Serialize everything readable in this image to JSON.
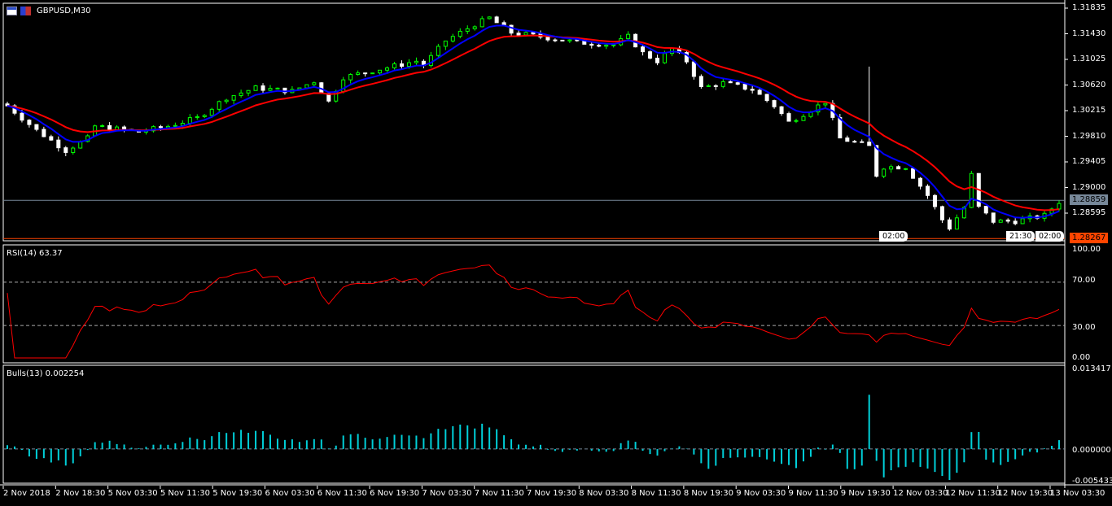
{
  "header": {
    "symbol_title": "GBPUSD,M30"
  },
  "colors": {
    "bull": "#00ff00",
    "bear": "#ffffff",
    "fast_ma": "#0000ff",
    "slow_ma": "#ff0000",
    "rsi": "#ff0000",
    "bulls": "#00cfd8",
    "bid_line": "#778899",
    "low_tag": "#ff4500"
  },
  "price_axis": {
    "labels": [
      "1.31835",
      "1.31430",
      "1.31025",
      "1.30620",
      "1.30215",
      "1.29810",
      "1.29405",
      "1.29000",
      "1.28595"
    ],
    "bid": "1.28859",
    "low": "1.28267"
  },
  "flags": [
    "02:00",
    "21:30",
    "02:00"
  ],
  "rsi": {
    "title": "RSI(14) 63.37",
    "labels": [
      "100.00",
      "70.00",
      "30.00",
      "0.00"
    ]
  },
  "bulls": {
    "title": "Bulls(13) 0.002254",
    "labels": [
      "0.013417",
      "0.000000",
      "-0.005433"
    ]
  },
  "time_axis": [
    "2 Nov 2018",
    "2 Nov 18:30",
    "5 Nov 03:30",
    "5 Nov 11:30",
    "5 Nov 19:30",
    "6 Nov 03:30",
    "6 Nov 11:30",
    "6 Nov 19:30",
    "7 Nov 03:30",
    "7 Nov 11:30",
    "7 Nov 19:30",
    "8 Nov 03:30",
    "8 Nov 11:30",
    "8 Nov 19:30",
    "9 Nov 03:30",
    "9 Nov 11:30",
    "9 Nov 19:30",
    "12 Nov 03:30",
    "12 Nov 11:30",
    "12 Nov 19:30",
    "13 Nov 03:30"
  ],
  "chart_data": {
    "type": "candlestick",
    "symbol": "GBPUSD",
    "timeframe": "M30",
    "bars": 145,
    "ylim": [
      1.28232,
      1.31911
    ],
    "close_anchors": [
      [
        0,
        1.30323
      ],
      [
        4,
        1.29945
      ],
      [
        8,
        1.2963
      ],
      [
        11,
        1.29819
      ],
      [
        12,
        1.30008
      ],
      [
        18,
        1.2992
      ],
      [
        22,
        1.30008
      ],
      [
        26,
        1.30134
      ],
      [
        30,
        1.30449
      ],
      [
        34,
        1.306
      ],
      [
        39,
        1.3055
      ],
      [
        42,
        1.30701
      ],
      [
        44,
        1.30386
      ],
      [
        46,
        1.30764
      ],
      [
        51,
        1.3089
      ],
      [
        56,
        1.31016
      ],
      [
        57,
        1.30953
      ],
      [
        60,
        1.31331
      ],
      [
        64,
        1.31583
      ],
      [
        66,
        1.31684
      ],
      [
        69,
        1.31457
      ],
      [
        73,
        1.31394
      ],
      [
        78,
        1.31306
      ],
      [
        83,
        1.31268
      ],
      [
        85,
        1.31394
      ],
      [
        87,
        1.31142
      ],
      [
        89,
        1.31016
      ],
      [
        91,
        1.31205
      ],
      [
        93,
        1.31016
      ],
      [
        95,
        1.306
      ],
      [
        98,
        1.30676
      ],
      [
        102,
        1.30575
      ],
      [
        105,
        1.30323
      ],
      [
        107,
        1.30071
      ],
      [
        110,
        1.3026
      ],
      [
        112,
        1.30386
      ],
      [
        114,
        1.29819
      ],
      [
        118,
        1.29693
      ],
      [
        119,
        1.29252
      ],
      [
        120,
        1.29378
      ],
      [
        123,
        1.29378
      ],
      [
        126,
        1.28937
      ],
      [
        128,
        1.28559
      ],
      [
        129,
        1.28433
      ],
      [
        131,
        1.28748
      ],
      [
        132,
        1.29252
      ],
      [
        133,
        1.28748
      ],
      [
        135,
        1.28536
      ],
      [
        138,
        1.28536
      ],
      [
        142,
        1.28625
      ],
      [
        144,
        1.28836
      ]
    ],
    "spike": {
      "bar": 118,
      "high": 1.3093
    },
    "indicators": [
      "MA fast (blue)",
      "MA slow (red)",
      "RSI(14)",
      "Bulls(13)"
    ],
    "rsi_ylim": [
      0,
      100
    ],
    "rsi_levels": [
      30,
      70
    ],
    "bulls_ylim": [
      -0.005433,
      0.013417
    ]
  }
}
